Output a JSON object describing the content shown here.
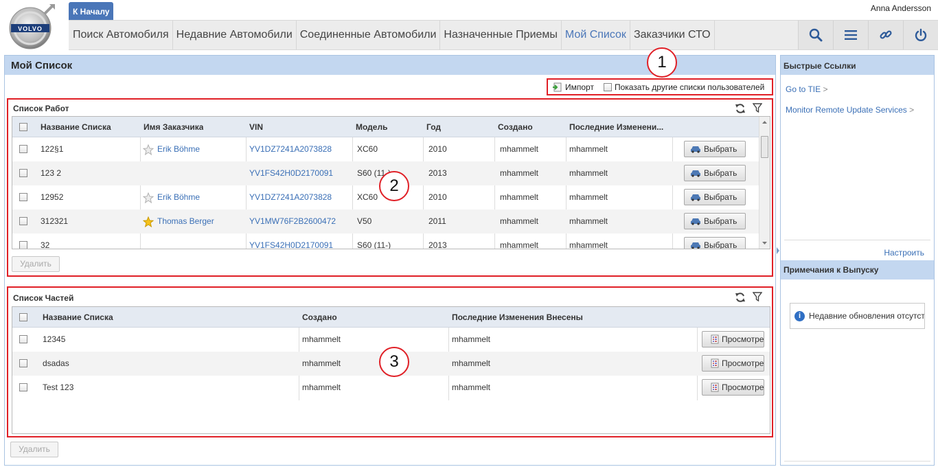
{
  "header": {
    "home_tab": "К Началу",
    "user_name": "Anna Andersson",
    "logo_text": "VOLVO",
    "nav": [
      {
        "label": "Поиск Автомобиля",
        "active": false
      },
      {
        "label": "Недавние Автомобили",
        "active": false
      },
      {
        "label": "Соединенные Автомобили",
        "active": false
      },
      {
        "label": "Назначенные Приемы",
        "active": false
      },
      {
        "label": "Мой Список",
        "active": true
      },
      {
        "label": "Заказчики СТО",
        "active": false
      }
    ],
    "icons": [
      "search-icon",
      "menu-icon",
      "link-icon",
      "power-icon"
    ]
  },
  "main": {
    "title": "Мой Список",
    "toolbar": {
      "import_label": "Импорт",
      "show_others_label": "Показать другие списки пользователей"
    },
    "callouts": [
      "1",
      "2",
      "3"
    ],
    "job_list": {
      "title": "Список Работ",
      "columns": [
        "Название Списка",
        "Имя Заказчика",
        "VIN",
        "Модель",
        "Год",
        "Создано",
        "Последние Изменени..."
      ],
      "rows": [
        {
          "name": "122§1",
          "customer": "Erik Böhme",
          "star": "empty",
          "vin": "YV1DZ7241A2073828",
          "model": "XC60",
          "year": "2010",
          "created": "mhammelt",
          "modified": "mhammelt",
          "action": "Выбрать"
        },
        {
          "name": "123 2",
          "customer": "",
          "star": "none",
          "vin": "YV1FS42H0D2170091",
          "model": "S60 (11-)",
          "year": "2013",
          "created": "mhammelt",
          "modified": "mhammelt",
          "action": "Выбрать"
        },
        {
          "name": "12952",
          "customer": "Erik Böhme",
          "star": "empty",
          "vin": "YV1DZ7241A2073828",
          "model": "XC60",
          "year": "2010",
          "created": "mhammelt",
          "modified": "mhammelt",
          "action": "Выбрать"
        },
        {
          "name": "312321",
          "customer": "Thomas Berger",
          "star": "filled",
          "vin": "YV1MW76F2B2600472",
          "model": "V50",
          "year": "2011",
          "created": "mhammelt",
          "modified": "mhammelt",
          "action": "Выбрать"
        },
        {
          "name": "32",
          "customer": "",
          "star": "none",
          "vin": "YV1FS42H0D2170091",
          "model": "S60 (11-)",
          "year": "2013",
          "created": "mhammelt",
          "modified": "mhammelt",
          "action": "Выбрать"
        }
      ],
      "delete_label": "Удалить"
    },
    "parts_list": {
      "title": "Список Частей",
      "columns": [
        "Название Списка",
        "Создано",
        "Последние Изменения Внесены"
      ],
      "rows": [
        {
          "name": "12345",
          "created": "mhammelt",
          "modified": "mhammelt",
          "action": "Просмотреть"
        },
        {
          "name": "dsadas",
          "created": "mhammelt",
          "modified": "mhammelt",
          "action": "Просмотреть"
        },
        {
          "name": "Test 123",
          "created": "mhammelt",
          "modified": "mhammelt",
          "action": "Просмотреть"
        }
      ],
      "delete_label": "Удалить"
    }
  },
  "side": {
    "quick_links_title": "Быстрые Ссылки",
    "links": [
      "Go to TIE",
      "Monitor Remote Update Services"
    ],
    "link_arrow": ">",
    "configure_label": "Настроить",
    "notes_title": "Примечания к Выпуску",
    "no_updates_text": "Недавние обновления отсутствуют"
  },
  "colors": {
    "accent_blue": "#4a76b8",
    "header_bar": "#c3d7f0",
    "highlight_red": "#e01f26",
    "link_blue": "#3a6fb6"
  }
}
